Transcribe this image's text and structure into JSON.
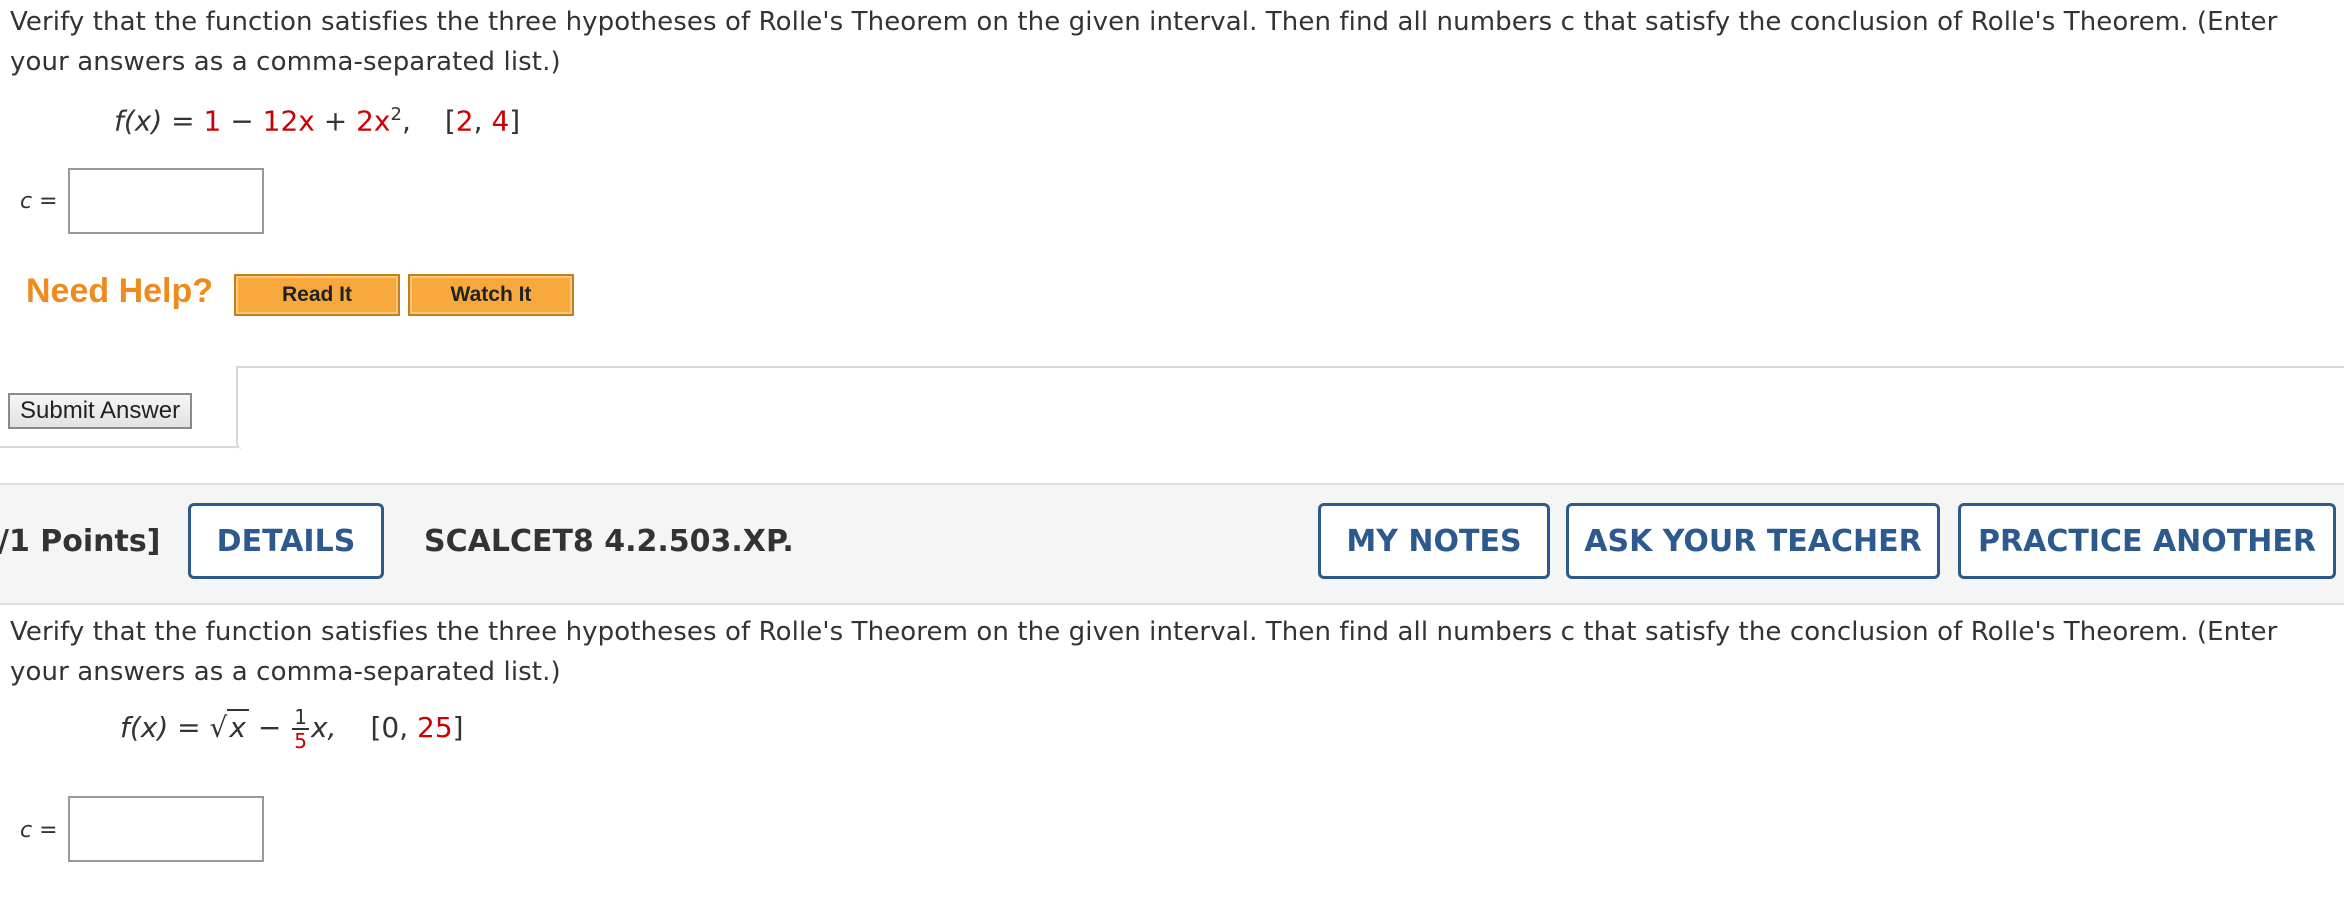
{
  "problem1": {
    "prompt_line1": "Verify that the function satisfies the three hypotheses of Rolle's Theorem on the given interval. Then find all numbers c that satisfy the conclusion of Rolle's Theorem. (Enter",
    "prompt_line2": "your answers as a comma-separated list.)",
    "function": {
      "lhs": "f(x) = ",
      "term1": "1",
      "minus": " − ",
      "term2": "12x",
      "plus": " + ",
      "term3": "2x",
      "exponent": "2",
      "comma": ",",
      "interval_open": "[",
      "a": "2",
      "sep": ", ",
      "b": "4",
      "interval_close": "]"
    },
    "answer_label": "c",
    "answer_eq": " =",
    "answer_value": ""
  },
  "help": {
    "label": "Need Help?",
    "read_it": "Read It",
    "watch_it": "Watch It"
  },
  "submit": {
    "label": "Submit Answer"
  },
  "header2": {
    "points": "/1 Points]",
    "details": "DETAILS",
    "code": "SCALCET8 4.2.503.XP.",
    "my_notes": "MY NOTES",
    "ask_teacher": "ASK YOUR TEACHER",
    "practice_another": "PRACTICE ANOTHER"
  },
  "problem2": {
    "prompt_line1": "Verify that the function satisfies the three hypotheses of Rolle's Theorem on the given interval. Then find all numbers c that satisfy the conclusion of Rolle's Theorem. (Enter",
    "prompt_line2": "your answers as a comma-separated list.)",
    "function": {
      "lhs": "f(x) = ",
      "sqrt_sign": "√",
      "radicand": "x",
      "minus": " − ",
      "frac_num": "1",
      "frac_den": "5",
      "var": "x,",
      "interval_open": "[",
      "a": "0",
      "sep": ", ",
      "b": "25",
      "interval_close": "]"
    },
    "answer_label": "c",
    "answer_eq": " =",
    "answer_value": ""
  },
  "colors": {
    "accent_blue": "#2d5a8e",
    "help_orange": "#ef8a1c",
    "button_orange": "#f7a93d",
    "value_red": "#cc0000"
  }
}
